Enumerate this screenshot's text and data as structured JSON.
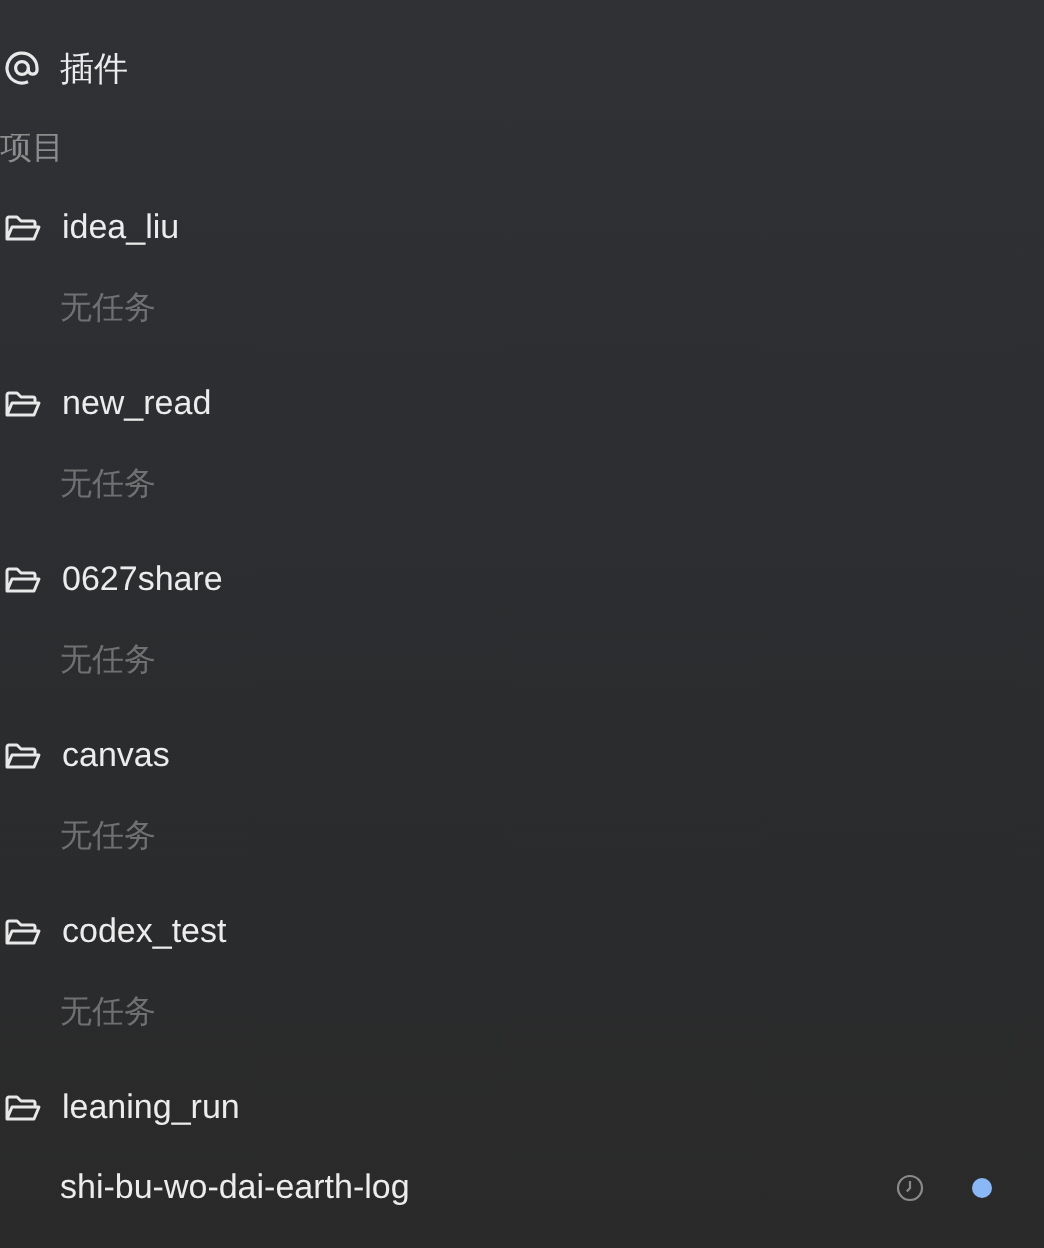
{
  "nav_items": [
    {
      "label": "插件"
    }
  ],
  "projects_section": {
    "title": "项目",
    "projects": [
      {
        "name": "idea_liu",
        "empty_text": "无任务"
      },
      {
        "name": "new_read",
        "empty_text": "无任务"
      },
      {
        "name": "0627share",
        "empty_text": "无任务"
      },
      {
        "name": "canvas",
        "empty_text": "无任务"
      },
      {
        "name": "codex_test",
        "empty_text": "无任务"
      },
      {
        "name": "leaning_run",
        "tasks": [
          {
            "title": "shi-bu-wo-dai-earth-log",
            "color": "#8ab8f5"
          }
        ]
      }
    ]
  }
}
